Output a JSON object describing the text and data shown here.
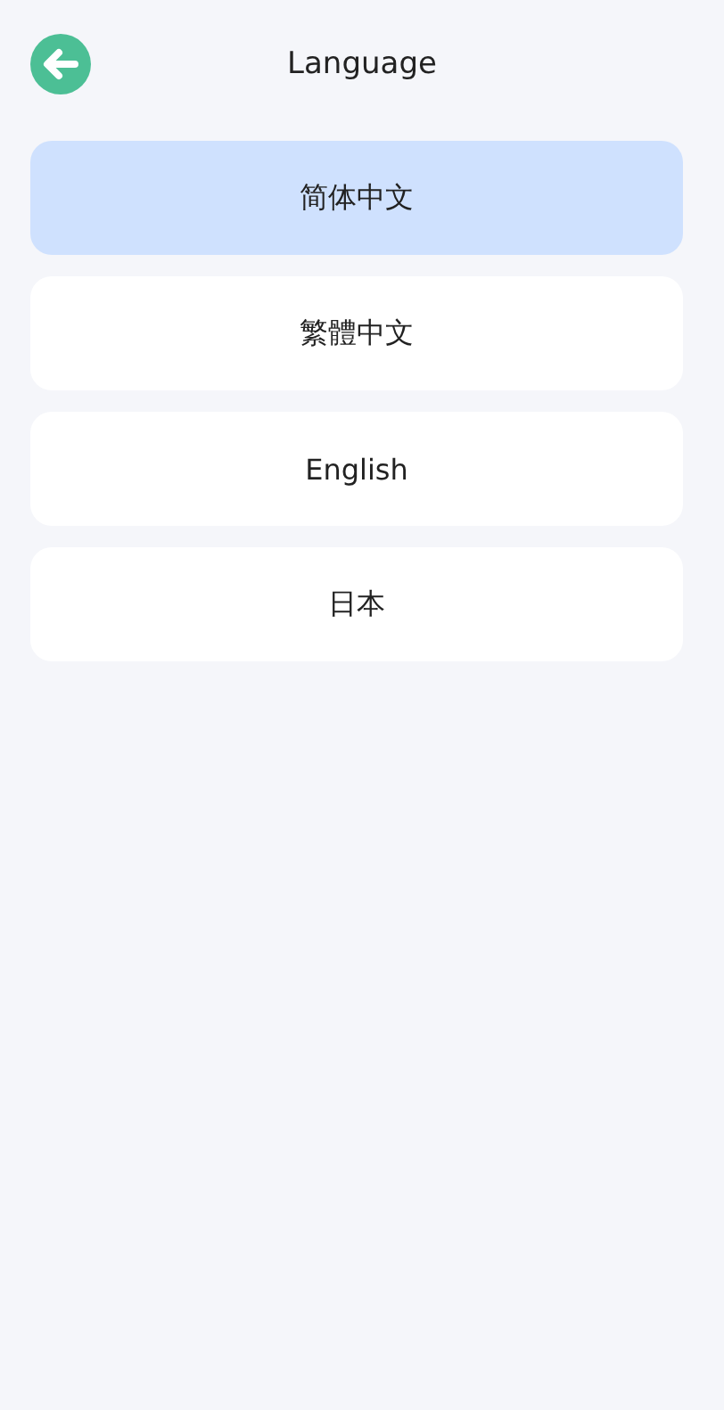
{
  "header": {
    "title": "Language"
  },
  "languages": [
    {
      "label": "简体中文",
      "selected": true
    },
    {
      "label": "繁體中文",
      "selected": false
    },
    {
      "label": "English",
      "selected": false
    },
    {
      "label": "日本",
      "selected": false
    }
  ]
}
